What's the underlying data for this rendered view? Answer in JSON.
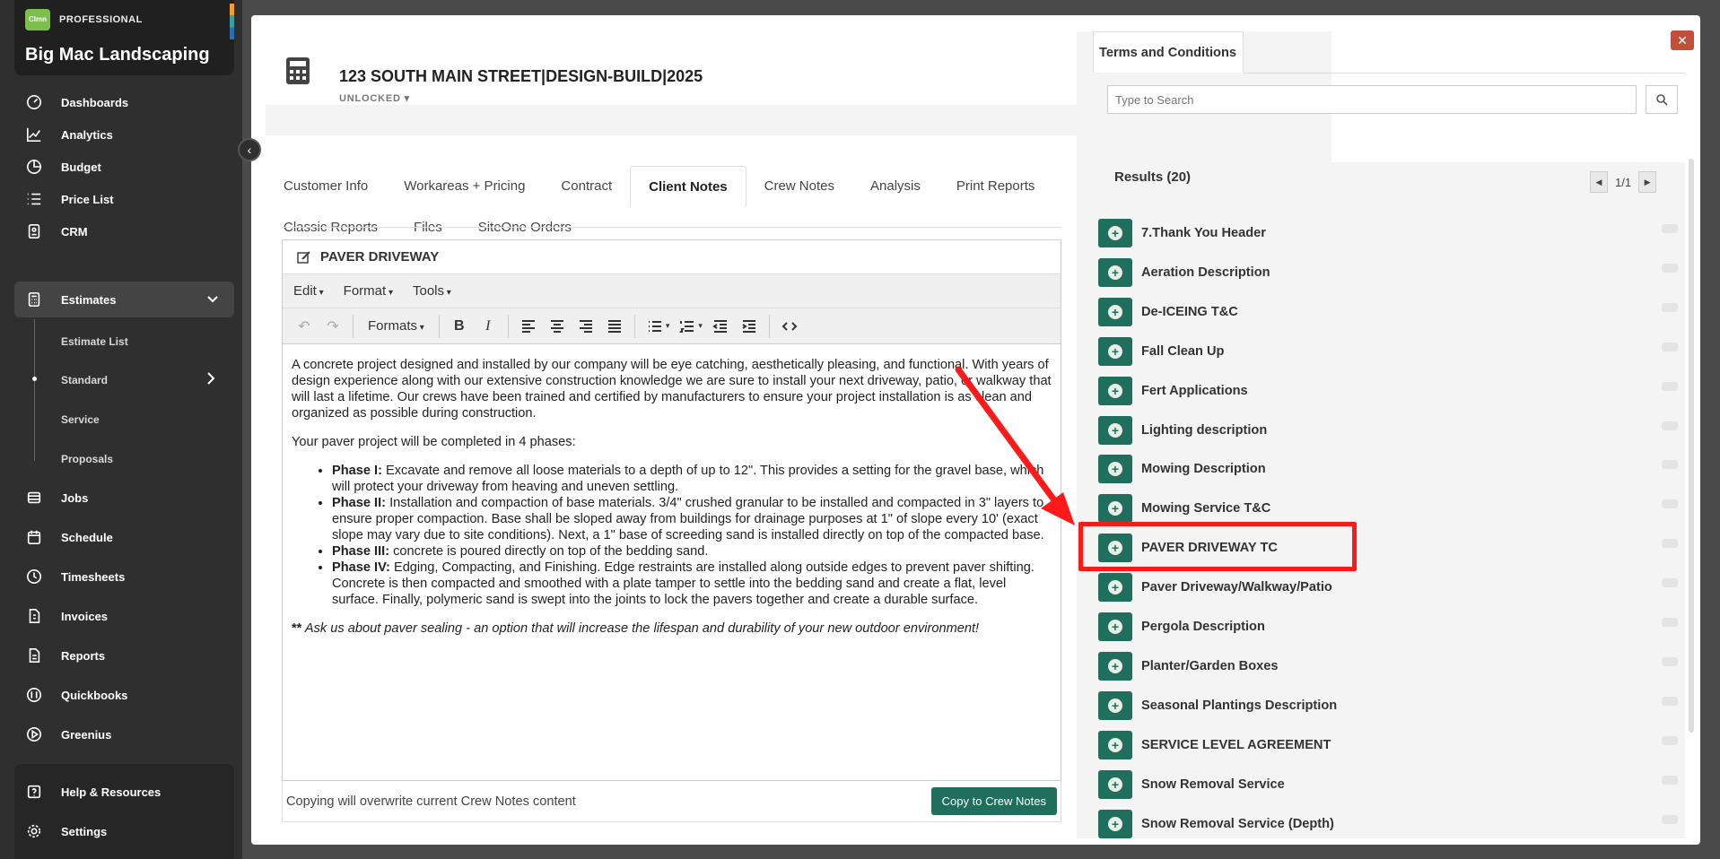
{
  "brand": {
    "logo_text": "Clmn",
    "tier": "PROFESSIONAL",
    "company": "Big Mac Landscaping"
  },
  "nav": {
    "dashboards": "Dashboards",
    "analytics": "Analytics",
    "budget": "Budget",
    "price_list": "Price List",
    "crm": "CRM",
    "estimates": "Estimates",
    "estimate_list": "Estimate List",
    "standard": "Standard",
    "service": "Service",
    "proposals": "Proposals",
    "jobs": "Jobs",
    "schedule": "Schedule",
    "timesheets": "Timesheets",
    "invoices": "Invoices",
    "reports": "Reports",
    "quickbooks": "Quickbooks",
    "greenius": "Greenius",
    "help": "Help & Resources",
    "settings": "Settings"
  },
  "project": {
    "title": "123 SOUTH MAIN STREET|DESIGN-BUILD|2025",
    "status": "UNLOCKED ▾"
  },
  "tabs": {
    "customer_info": "Customer Info",
    "workareas": "Workareas + Pricing",
    "contract": "Contract",
    "client_notes": "Client Notes",
    "crew_notes": "Crew Notes",
    "analysis": "Analysis",
    "print_reports": "Print Reports",
    "classic_reports": "Classic Reports",
    "files": "Files",
    "siteone": "SiteOne Orders"
  },
  "editor": {
    "title": "PAVER DRIVEWAY",
    "menu_edit": "Edit",
    "menu_format": "Format",
    "menu_tools": "Tools",
    "formats": "Formats",
    "para1": "A concrete project designed and installed by our company will be eye catching, aesthetically pleasing, and functional. With years of design experience along with our extensive construction knowledge we are sure to install your next driveway, patio, or walkway that will last a lifetime.  Our crews have been trained and certified by manufacturers to ensure your project installation is as clean and organized as possible during construction.",
    "para2": "Your paver project will be completed in 4 phases:",
    "phase1_label": "Phase I:",
    "phase1_text": "  Excavate and remove all loose materials to a depth of up to 12\".  This provides a setting for the gravel base, which will protect your driveway from heaving and uneven settling.",
    "phase2_label": "Phase II:",
    "phase2_text": "  Installation and compaction of base materials.  3/4\" crushed granular to be installed and compacted in 3\" layers to ensure proper compaction.  Base shall be sloped away from buildings for drainage purposes at 1\" of slope every 10' (exact slope may vary due to site conditions).  Next, a 1\" base of screeding sand is installed directly on top of the compacted base.",
    "phase3_label": "Phase III:",
    "phase3_text": " concrete is poured directly on top of the bedding sand.",
    "phase4_label": "Phase IV:",
    "phase4_text": " Edging, Compacting, and Finishing.  Edge restraints are installed along outside edges to prevent paver shifting.  Concrete is then compacted and smoothed with a plate tamper to settle into the bedding sand and create a flat, level surface.  Finally, polymeric sand is swept into the joints to lock the pavers together and create a durable surface.",
    "note_stars": "**",
    "note_text": " Ask us about paver sealing - an option that will increase the lifespan and durability of your new outdoor environment!",
    "footer_note": "Copying will overwrite current Crew Notes content",
    "copy_button": "Copy to Crew Notes"
  },
  "tc": {
    "tab_label": "Terms and Conditions",
    "search_placeholder": "Type to Search",
    "results_label": "Results   (20)",
    "page": "1/1",
    "items": [
      "7.Thank You Header",
      "Aeration Description",
      "De-ICEING T&C",
      "Fall Clean Up",
      "Fert Applications",
      "Lighting description",
      "Mowing Description",
      "Mowing Service T&C",
      "PAVER DRIVEWAY TC",
      "Paver Driveway/Walkway/Patio",
      "Pergola Description",
      "Planter/Garden Boxes",
      "Seasonal Plantings Description",
      "SERVICE LEVEL AGREEMENT",
      "Snow Removal Service",
      "Snow Removal Service (Depth)"
    ]
  },
  "colors": {
    "accent_green": "#1f6f5c",
    "annotation_red": "#ff1a1a",
    "sidebar_bg": "#2f2f2f"
  }
}
